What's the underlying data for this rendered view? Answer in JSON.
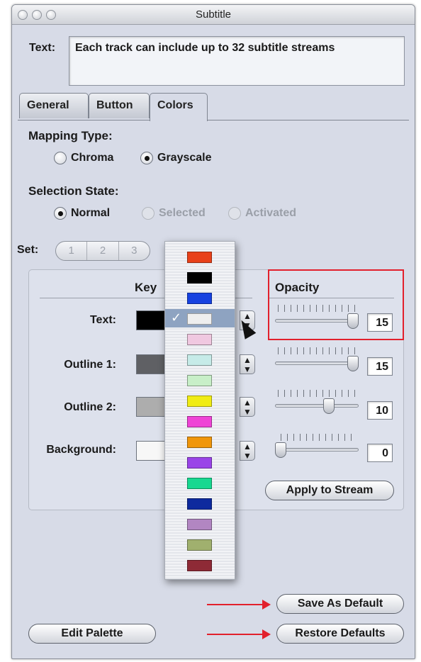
{
  "window": {
    "title": "Subtitle"
  },
  "text_field": {
    "label": "Text:",
    "value": "Each track can include up to 32 subtitle streams"
  },
  "tabs": [
    {
      "label": "General",
      "active": false
    },
    {
      "label": "Button",
      "active": false
    },
    {
      "label": "Colors",
      "active": true
    }
  ],
  "mapping_type": {
    "label": "Mapping Type:",
    "options": [
      {
        "label": "Chroma",
        "selected": false
      },
      {
        "label": "Grayscale",
        "selected": true
      }
    ]
  },
  "selection_state": {
    "label": "Selection State:",
    "options": [
      {
        "label": "Normal",
        "selected": true,
        "enabled": true
      },
      {
        "label": "Selected",
        "selected": false,
        "enabled": false
      },
      {
        "label": "Activated",
        "selected": false,
        "enabled": false
      }
    ]
  },
  "set": {
    "label": "Set:",
    "options": [
      "1",
      "2",
      "3"
    ]
  },
  "columns": {
    "key": "Key",
    "opacity": "Opacity"
  },
  "rows": [
    {
      "label": "Text:",
      "key_color": "#000000",
      "opacity": "15",
      "opacity_fraction": 1.0
    },
    {
      "label": "Outline 1:",
      "key_color": "#5f6064",
      "opacity": "15",
      "opacity_fraction": 1.0
    },
    {
      "label": "Outline 2:",
      "key_color": "#adadad",
      "opacity": "10",
      "opacity_fraction": 0.667
    },
    {
      "label": "Background:",
      "key_color": "#f7f7f7",
      "opacity": "0",
      "opacity_fraction": 0.0
    }
  ],
  "buttons": {
    "apply_to_stream": "Apply to Stream",
    "save_as_default": "Save As Default",
    "restore_defaults": "Restore Defaults",
    "edit_palette": "Edit Palette"
  },
  "color_menu": {
    "selected_index": 3,
    "colors": [
      "#e8411a",
      "#000000",
      "#1742e0",
      "#eeeeee",
      "#f0c8e0",
      "#c6ebe8",
      "#c8efc8",
      "#f0ec14",
      "#ef44d6",
      "#f0960a",
      "#9a44e8",
      "#18d890",
      "#0e2a9e",
      "#b286c2",
      "#a0b06e",
      "#8e2a36"
    ]
  },
  "annotation_color": "#e2202c"
}
